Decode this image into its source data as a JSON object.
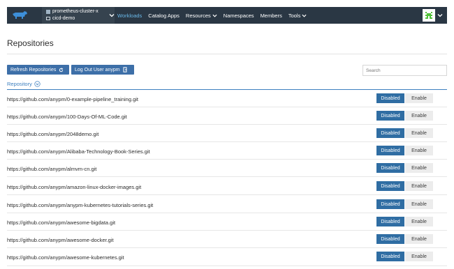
{
  "header": {
    "cluster_name": "prometheus-cluster-x",
    "project_name": "cicd-demo",
    "nav": [
      {
        "label": "Workloads",
        "active": true,
        "dropdown": false
      },
      {
        "label": "Catalog Apps",
        "active": false,
        "dropdown": false
      },
      {
        "label": "Resources",
        "active": false,
        "dropdown": true
      },
      {
        "label": "Namespaces",
        "active": false,
        "dropdown": false
      },
      {
        "label": "Members",
        "active": false,
        "dropdown": false
      },
      {
        "label": "Tools",
        "active": false,
        "dropdown": true
      }
    ],
    "colors": {
      "bar": "#2a3744",
      "active": "#6ab8e8"
    }
  },
  "page": {
    "title": "Repositories",
    "refresh_label": "Refresh Repositories",
    "logout_label": "Log Out User anypm",
    "search_placeholder": "Search",
    "column_header": "Repository"
  },
  "repositories": [
    {
      "url": "https://github.com/anypm/0-example-pipeline_training.git",
      "disabled_label": "Disabled",
      "enable_label": "Enable"
    },
    {
      "url": "https://github.com/anypm/100-Days-Of-ML-Code.git",
      "disabled_label": "Disabled",
      "enable_label": "Enable"
    },
    {
      "url": "https://github.com/anypm/2048demo.git",
      "disabled_label": "Disabled",
      "enable_label": "Enable"
    },
    {
      "url": "https://github.com/anypm/Alibaba-Technology-Book-Series.git",
      "disabled_label": "Disabled",
      "enable_label": "Enable"
    },
    {
      "url": "https://github.com/anypm/almvm-cn.git",
      "disabled_label": "Disabled",
      "enable_label": "Enable"
    },
    {
      "url": "https://github.com/anypm/amazon-linux-docker-images.git",
      "disabled_label": "Disabled",
      "enable_label": "Enable"
    },
    {
      "url": "https://github.com/anypm/anypm-kubernetes-tutorials-series.git",
      "disabled_label": "Disabled",
      "enable_label": "Enable"
    },
    {
      "url": "https://github.com/anypm/awesome-bigdata.git",
      "disabled_label": "Disabled",
      "enable_label": "Enable"
    },
    {
      "url": "https://github.com/anypm/awesome-docker.git",
      "disabled_label": "Disabled",
      "enable_label": "Enable"
    },
    {
      "url": "https://github.com/anypm/awesome-kubernetes.git",
      "disabled_label": "Disabled",
      "enable_label": "Enable"
    }
  ]
}
